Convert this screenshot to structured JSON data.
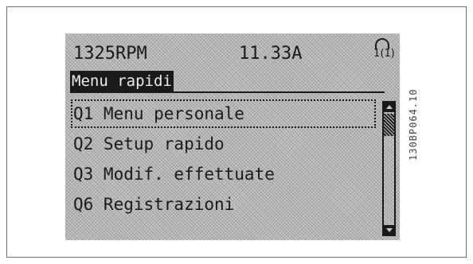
{
  "status": {
    "speed": "1325RPM",
    "current": "11.33A",
    "setup_indicator": "1(1)"
  },
  "title": "Menu rapidi",
  "menu": {
    "items": [
      {
        "label": "Q1 Menu personale",
        "selected": true
      },
      {
        "label": "Q2 Setup rapido",
        "selected": false
      },
      {
        "label": "Q3 Modif. effettuate",
        "selected": false
      },
      {
        "label": "Q6 Registrazioni",
        "selected": false
      }
    ]
  },
  "scrollbar": {
    "position_fraction": 0.0
  },
  "figure_code": "130BP064.10",
  "colors": {
    "lcd_background": "#c8c8c8",
    "lcd_foreground": "#1a1a1a",
    "frame_border": "#6f6f6f"
  }
}
